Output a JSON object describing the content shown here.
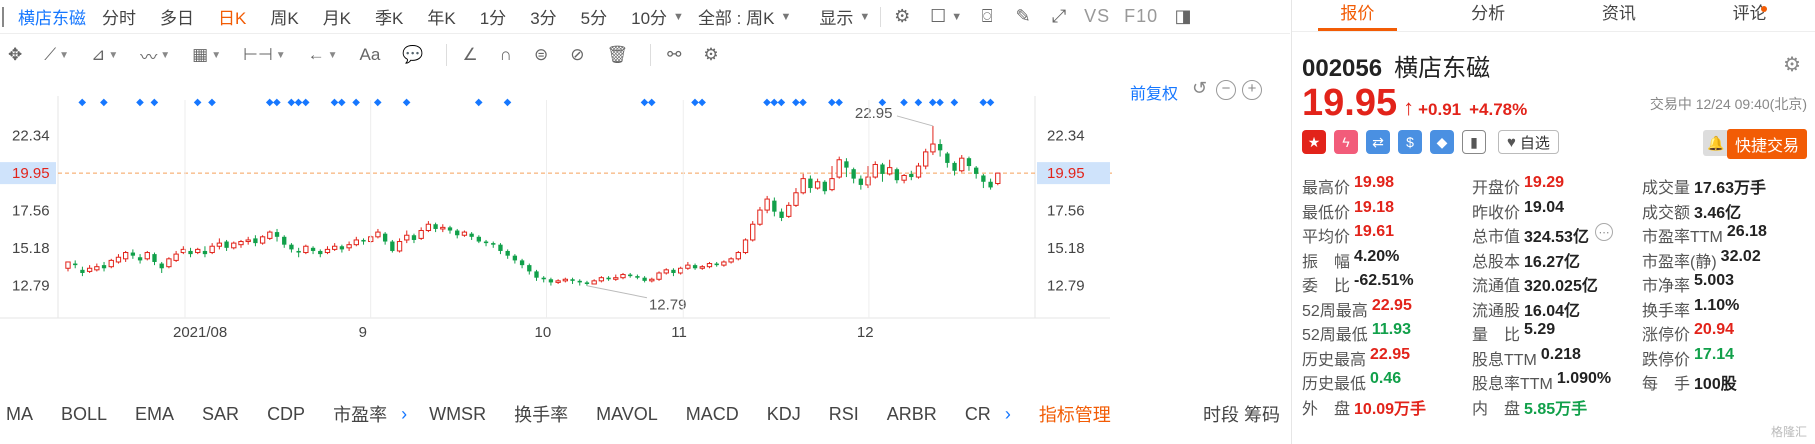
{
  "toolbar": {
    "stock_name": "横店东磁",
    "periods": [
      "分时",
      "多日",
      "日K",
      "周K",
      "月K",
      "季K",
      "年K",
      "1分",
      "3分",
      "5分",
      "10分"
    ],
    "active_period": "日K",
    "scope_select": "全部 : 周K",
    "display_label": "显示",
    "vs_label": "VS",
    "f10_label": "F10"
  },
  "chart_header": {
    "adjust_label": "前复权"
  },
  "chart_data": {
    "type": "candlestick",
    "x_ticks": [
      "2021/08",
      "9",
      "10",
      "11",
      "12"
    ],
    "y_ticks": [
      "22.34",
      "19.95",
      "17.56",
      "15.18",
      "12.79"
    ],
    "ylim": [
      11.5,
      24.6
    ],
    "current_price_line": "19.95",
    "high_annotation": "22.95",
    "low_annotation": "12.79",
    "candles": [
      [
        13.9,
        14.3,
        13.7,
        14.2
      ],
      [
        14.2,
        14.1,
        13.9,
        14.4
      ],
      [
        13.8,
        13.6,
        13.4,
        14.0
      ],
      [
        13.7,
        13.9,
        13.6,
        14.1
      ],
      [
        13.8,
        14.0,
        13.7,
        14.2
      ],
      [
        14.1,
        13.9,
        13.7,
        14.3
      ],
      [
        14.0,
        14.4,
        13.9,
        14.5
      ],
      [
        14.3,
        14.6,
        14.2,
        14.8
      ],
      [
        14.5,
        14.9,
        14.3,
        15.0
      ],
      [
        14.9,
        14.7,
        14.5,
        15.1
      ],
      [
        14.6,
        14.4,
        14.2,
        14.8
      ],
      [
        14.5,
        14.9,
        14.4,
        15.0
      ],
      [
        14.8,
        14.3,
        14.1,
        14.9
      ],
      [
        14.2,
        13.9,
        13.6,
        14.3
      ],
      [
        14.0,
        14.5,
        13.9,
        14.6
      ],
      [
        14.4,
        14.8,
        14.3,
        15.0
      ],
      [
        14.9,
        15.1,
        14.8,
        15.3
      ],
      [
        15.0,
        14.8,
        14.6,
        15.2
      ],
      [
        14.9,
        15.1,
        14.8,
        15.2
      ],
      [
        15.0,
        14.8,
        14.6,
        15.3
      ],
      [
        14.9,
        15.3,
        14.8,
        15.5
      ],
      [
        15.3,
        15.5,
        15.1,
        15.8
      ],
      [
        15.6,
        15.2,
        15.0,
        15.7
      ],
      [
        15.2,
        15.5,
        15.1,
        15.6
      ],
      [
        15.4,
        15.6,
        15.2,
        15.7
      ],
      [
        15.6,
        15.7,
        15.4,
        15.9
      ],
      [
        15.8,
        15.5,
        15.3,
        16.0
      ],
      [
        15.5,
        15.9,
        15.4,
        16.0
      ],
      [
        15.8,
        16.2,
        15.7,
        16.3
      ],
      [
        16.2,
        15.9,
        15.6,
        16.4
      ],
      [
        15.9,
        15.4,
        15.2,
        16.0
      ],
      [
        15.4,
        15.1,
        14.9,
        15.5
      ],
      [
        15.0,
        14.9,
        14.6,
        15.2
      ],
      [
        14.9,
        15.3,
        14.8,
        15.4
      ],
      [
        15.2,
        15.0,
        14.8,
        15.3
      ],
      [
        15.0,
        14.8,
        14.6,
        15.1
      ],
      [
        14.9,
        15.1,
        14.8,
        15.3
      ],
      [
        15.1,
        15.3,
        15.0,
        15.5
      ],
      [
        15.3,
        15.1,
        14.9,
        15.4
      ],
      [
        15.2,
        15.4,
        15.0,
        15.6
      ],
      [
        15.4,
        15.7,
        15.3,
        15.9
      ],
      [
        15.7,
        15.6,
        15.4,
        15.8
      ],
      [
        15.6,
        15.9,
        15.5,
        16.0
      ],
      [
        15.9,
        16.2,
        15.8,
        16.4
      ],
      [
        16.1,
        15.6,
        15.4,
        16.2
      ],
      [
        15.6,
        15.0,
        14.9,
        15.7
      ],
      [
        15.0,
        15.6,
        14.9,
        15.8
      ],
      [
        15.7,
        16.0,
        15.5,
        16.3
      ],
      [
        16.0,
        15.7,
        15.5,
        16.1
      ],
      [
        15.8,
        16.3,
        15.7,
        16.5
      ],
      [
        16.3,
        16.7,
        16.2,
        16.9
      ],
      [
        16.7,
        16.4,
        16.2,
        16.8
      ],
      [
        16.4,
        16.5,
        16.2,
        16.7
      ],
      [
        16.5,
        16.3,
        16.1,
        16.6
      ],
      [
        16.3,
        16.0,
        15.8,
        16.4
      ],
      [
        16.0,
        16.2,
        15.9,
        16.3
      ],
      [
        16.1,
        15.9,
        15.7,
        16.2
      ],
      [
        15.9,
        15.6,
        15.5,
        16.0
      ],
      [
        15.6,
        15.5,
        15.3,
        15.7
      ],
      [
        15.5,
        15.4,
        15.2,
        15.6
      ],
      [
        15.4,
        15.0,
        14.8,
        15.5
      ],
      [
        15.0,
        14.7,
        14.5,
        15.1
      ],
      [
        14.7,
        14.4,
        14.2,
        14.8
      ],
      [
        14.4,
        14.1,
        13.9,
        14.5
      ],
      [
        14.1,
        13.7,
        13.5,
        14.2
      ],
      [
        13.7,
        13.3,
        13.1,
        13.8
      ],
      [
        13.3,
        13.2,
        13.0,
        13.4
      ],
      [
        13.2,
        13.0,
        12.8,
        13.3
      ],
      [
        13.0,
        13.1,
        12.9,
        13.2
      ],
      [
        13.1,
        13.2,
        13.0,
        13.3
      ],
      [
        13.2,
        13.1,
        12.9,
        13.3
      ],
      [
        13.1,
        13.0,
        12.8,
        13.2
      ],
      [
        13.0,
        12.9,
        12.79,
        13.1
      ],
      [
        12.9,
        13.1,
        12.9,
        13.2
      ],
      [
        13.1,
        13.3,
        13.0,
        13.4
      ],
      [
        13.3,
        13.2,
        13.1,
        13.4
      ],
      [
        13.2,
        13.3,
        13.1,
        13.5
      ],
      [
        13.3,
        13.5,
        13.2,
        13.6
      ],
      [
        13.5,
        13.4,
        13.3,
        13.6
      ],
      [
        13.4,
        13.3,
        13.2,
        13.5
      ],
      [
        13.3,
        13.1,
        13.0,
        13.4
      ],
      [
        13.1,
        13.2,
        13.0,
        13.3
      ],
      [
        13.2,
        13.6,
        13.1,
        13.7
      ],
      [
        13.6,
        13.8,
        13.5,
        13.9
      ],
      [
        13.8,
        13.6,
        13.4,
        13.9
      ],
      [
        13.6,
        13.9,
        13.5,
        14.0
      ],
      [
        13.9,
        14.1,
        13.8,
        14.3
      ],
      [
        14.1,
        13.9,
        13.8,
        14.2
      ],
      [
        13.9,
        14.0,
        13.8,
        14.1
      ],
      [
        14.0,
        14.2,
        13.9,
        14.3
      ],
      [
        14.2,
        14.1,
        14.0,
        14.3
      ],
      [
        14.1,
        14.3,
        14.0,
        14.4
      ],
      [
        14.3,
        14.5,
        14.2,
        14.6
      ],
      [
        14.5,
        14.9,
        14.4,
        15.0
      ],
      [
        14.9,
        15.7,
        14.8,
        15.8
      ],
      [
        15.7,
        16.7,
        15.6,
        16.9
      ],
      [
        16.7,
        17.6,
        16.6,
        17.8
      ],
      [
        17.6,
        18.3,
        17.4,
        18.5
      ],
      [
        18.2,
        17.5,
        17.2,
        18.4
      ],
      [
        17.5,
        17.1,
        16.9,
        17.7
      ],
      [
        17.2,
        17.9,
        17.1,
        18.1
      ],
      [
        17.9,
        18.7,
        17.8,
        19.0
      ],
      [
        18.7,
        19.6,
        18.6,
        19.9
      ],
      [
        19.6,
        19.0,
        18.7,
        19.8
      ],
      [
        19.0,
        19.4,
        18.9,
        19.6
      ],
      [
        19.4,
        18.8,
        18.6,
        19.5
      ],
      [
        18.9,
        19.6,
        18.8,
        20.4
      ],
      [
        19.7,
        20.8,
        19.6,
        21.0
      ],
      [
        20.7,
        20.3,
        19.7,
        20.9
      ],
      [
        20.2,
        19.6,
        19.3,
        20.3
      ],
      [
        19.6,
        19.2,
        18.9,
        19.8
      ],
      [
        19.2,
        19.7,
        19.0,
        20.4
      ],
      [
        19.7,
        20.5,
        19.6,
        20.7
      ],
      [
        20.5,
        19.9,
        19.4,
        20.6
      ],
      [
        19.9,
        20.3,
        19.8,
        20.8
      ],
      [
        20.2,
        19.5,
        19.3,
        20.3
      ],
      [
        19.5,
        19.8,
        19.3,
        19.9
      ],
      [
        19.9,
        19.7,
        19.5,
        20.1
      ],
      [
        19.7,
        20.4,
        19.6,
        20.6
      ],
      [
        20.4,
        21.3,
        20.2,
        21.5
      ],
      [
        21.3,
        21.8,
        21.1,
        22.95
      ],
      [
        21.8,
        21.4,
        21.0,
        22.1
      ],
      [
        21.2,
        20.6,
        20.3,
        21.3
      ],
      [
        20.6,
        20.1,
        19.8,
        20.7
      ],
      [
        20.1,
        20.9,
        20.0,
        21.1
      ],
      [
        20.9,
        20.4,
        20.1,
        21.0
      ],
      [
        20.3,
        19.9,
        19.6,
        20.4
      ],
      [
        19.8,
        19.4,
        19.0,
        19.9
      ],
      [
        19.4,
        19.04,
        18.9,
        19.6
      ],
      [
        19.29,
        19.95,
        19.18,
        19.98
      ]
    ]
  },
  "indicators": [
    "MA",
    "BOLL",
    "EMA",
    "SAR",
    "CDP",
    "市盈率",
    "WMSR",
    "换手率",
    "MAVOL",
    "MACD",
    "KDJ",
    "RSI",
    "ARBR",
    "CR"
  ],
  "indicator_manage": "指标管理",
  "indicator_right": "时段 筹码",
  "quote": {
    "tabs": [
      "报价",
      "分析",
      "资讯",
      "评论"
    ],
    "active_tab": "报价",
    "code": "002056",
    "name": "横店东磁",
    "price": "19.95",
    "change": "+0.91",
    "change_pct": "+4.78%",
    "trade_status": "交易中 12/24 09:40(北京)",
    "watch_label": "自选",
    "fast_trade_label": "快捷交易",
    "rows": [
      [
        {
          "label": "最高价",
          "value": "19.98",
          "color": "red"
        },
        {
          "label": "开盘价",
          "value": "19.29",
          "color": "red"
        },
        {
          "label": "成交量",
          "value": "17.63万手",
          "color": "dark"
        }
      ],
      [
        {
          "label": "最低价",
          "value": "19.18",
          "color": "red"
        },
        {
          "label": "昨收价",
          "value": "19.04",
          "color": "dark"
        },
        {
          "label": "成交额",
          "value": "3.46亿",
          "color": "dark"
        }
      ],
      [
        {
          "label": "平均价",
          "value": "19.61",
          "color": "red"
        },
        {
          "label": "总市值",
          "value": "324.53亿",
          "color": "dark"
        },
        {
          "label": "市盈率TTM",
          "value": "26.18",
          "color": "dark"
        }
      ],
      [
        {
          "label": "振　幅",
          "value": "4.20%",
          "color": "dark"
        },
        {
          "label": "总股本",
          "value": "16.27亿",
          "color": "dark"
        },
        {
          "label": "市盈率(静)",
          "value": "32.02",
          "color": "dark"
        }
      ],
      [
        {
          "label": "委　比",
          "value": "-62.51%",
          "color": "dark"
        },
        {
          "label": "流通值",
          "value": "320.025亿",
          "color": "dark"
        },
        {
          "label": "市净率",
          "value": "5.003",
          "color": "dark"
        }
      ],
      [
        {
          "label": "52周最高",
          "value": "22.95",
          "color": "red"
        },
        {
          "label": "流通股",
          "value": "16.04亿",
          "color": "dark"
        },
        {
          "label": "换手率",
          "value": "1.10%",
          "color": "dark"
        }
      ],
      [
        {
          "label": "52周最低",
          "value": "11.93",
          "color": "green"
        },
        {
          "label": "量　比",
          "value": "5.29",
          "color": "dark"
        },
        {
          "label": "涨停价",
          "value": "20.94",
          "color": "red"
        }
      ],
      [
        {
          "label": "历史最高",
          "value": "22.95",
          "color": "red"
        },
        {
          "label": "股息TTM",
          "value": "0.218",
          "color": "dark"
        },
        {
          "label": "跌停价",
          "value": "17.14",
          "color": "green"
        }
      ],
      [
        {
          "label": "历史最低",
          "value": "0.46",
          "color": "green"
        },
        {
          "label": "股息率TTM",
          "value": "1.090%",
          "color": "dark"
        },
        {
          "label": "每　手",
          "value": "100股",
          "color": "dark"
        }
      ],
      [
        {
          "label": "外　盘",
          "value": "10.09万手",
          "color": "red"
        },
        {
          "label": "内　盘",
          "value": "5.85万手",
          "color": "green"
        },
        {
          "label": "",
          "value": "",
          "color": "dark"
        }
      ]
    ],
    "watermark": "格隆汇"
  },
  "colors": {
    "up": "#e2231a",
    "down": "#11a04a",
    "accent": "#f25c05",
    "link": "#1677ff"
  }
}
